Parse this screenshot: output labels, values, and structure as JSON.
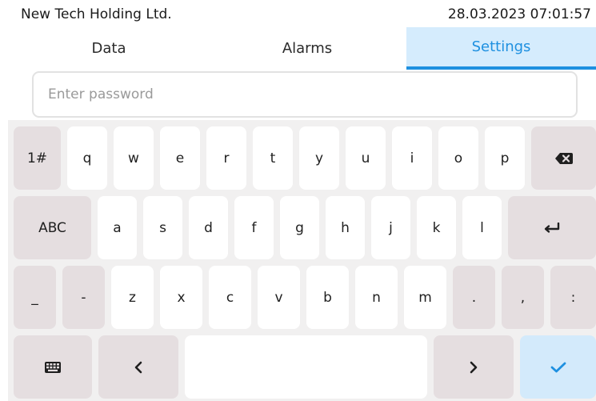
{
  "header": {
    "company": "New Tech Holding Ltd.",
    "datetime": "28.03.2023 07:01:57"
  },
  "tabs": [
    {
      "label": "Data",
      "active": false
    },
    {
      "label": "Alarms",
      "active": false
    },
    {
      "label": "Settings",
      "active": true
    }
  ],
  "password_field": {
    "placeholder": "Enter password",
    "value": ""
  },
  "keyboard": {
    "row1": [
      "1#",
      "q",
      "w",
      "e",
      "r",
      "t",
      "y",
      "u",
      "i",
      "o",
      "p"
    ],
    "row2": [
      "ABC",
      "a",
      "s",
      "d",
      "f",
      "g",
      "h",
      "j",
      "k",
      "l"
    ],
    "row3": [
      "_",
      "-",
      "z",
      "x",
      "c",
      "v",
      "b",
      "n",
      "m",
      ".",
      ",",
      ":"
    ],
    "icons": {
      "backspace": "backspace-icon",
      "enter": "enter-icon",
      "keyboard": "keyboard-icon",
      "left": "chevron-left-icon",
      "right": "chevron-right-icon",
      "confirm": "checkmark-icon"
    }
  },
  "colors": {
    "accent": "#1e90e0",
    "active_tab_bg": "#d5ecfd",
    "control_key_bg": "#e5dee0",
    "confirm_key_bg": "#d3eafb",
    "keyboard_bg": "#f1f0f0"
  }
}
